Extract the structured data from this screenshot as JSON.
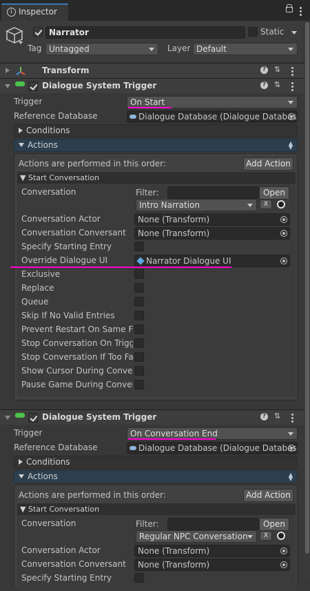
{
  "tab": {
    "title": "Inspector"
  },
  "object": {
    "name": "Narrator",
    "static_label": "Static",
    "tag_label": "Tag",
    "tag_value": "Untagged",
    "layer_label": "Layer",
    "layer_value": "Default"
  },
  "transform": {
    "title": "Transform"
  },
  "trigger1": {
    "title": "Dialogue System Trigger",
    "trigger_label": "Trigger",
    "trigger_value": "On Start",
    "db_label": "Reference Database",
    "db_value": "Dialogue Database (Dialogue Databas",
    "conditions_label": "Conditions",
    "actions_label": "Actions",
    "order_text": "Actions are performed in this order:",
    "add_action": "Add Action",
    "start_conv": "Start Conversation",
    "conv_label": "Conversation",
    "filter_label": "Filter:",
    "open_label": "Open",
    "conv_value": "Intro Narration",
    "x_label": "X",
    "actor_label": "Conversation Actor",
    "actor_value": "None (Transform)",
    "conversant_label": "Conversation Conversant",
    "conversant_value": "None (Transform)",
    "specify_label": "Specify Starting Entry",
    "override_label": "Override Dialogue UI",
    "override_value": "Narrator Dialogue UI",
    "exclusive_label": "Exclusive",
    "replace_label": "Replace",
    "queue_label": "Queue",
    "skip_label": "Skip If No Valid Entries",
    "prevent_label": "Prevent Restart On Same Fra",
    "stop_trigger_label": "Stop Conversation On Trigge",
    "stop_far_label": "Stop Conversation If Too Far",
    "cursor_label": "Show Cursor During Convers",
    "pause_label": "Pause Game During Convers"
  },
  "trigger2": {
    "title": "Dialogue System Trigger",
    "trigger_label": "Trigger",
    "trigger_value": "On Conversation End",
    "db_label": "Reference Database",
    "db_value": "Dialogue Database (Dialogue Databas",
    "conditions_label": "Conditions",
    "actions_label": "Actions",
    "order_text": "Actions are performed in this order:",
    "add_action": "Add Action",
    "start_conv": "Start Conversation",
    "conv_label": "Conversation",
    "filter_label": "Filter:",
    "open_label": "Open",
    "conv_value": "Regular NPC Conversation",
    "x_label": "X",
    "actor_label": "Conversation Actor",
    "actor_value": "None (Transform)",
    "conversant_label": "Conversation Conversant",
    "conversant_value": "None (Transform)",
    "specify_label": "Specify Starting Entry"
  },
  "colors": {
    "annotation": "#ff00d0",
    "background": "#383838",
    "actions_header": "#2c3f4f"
  }
}
